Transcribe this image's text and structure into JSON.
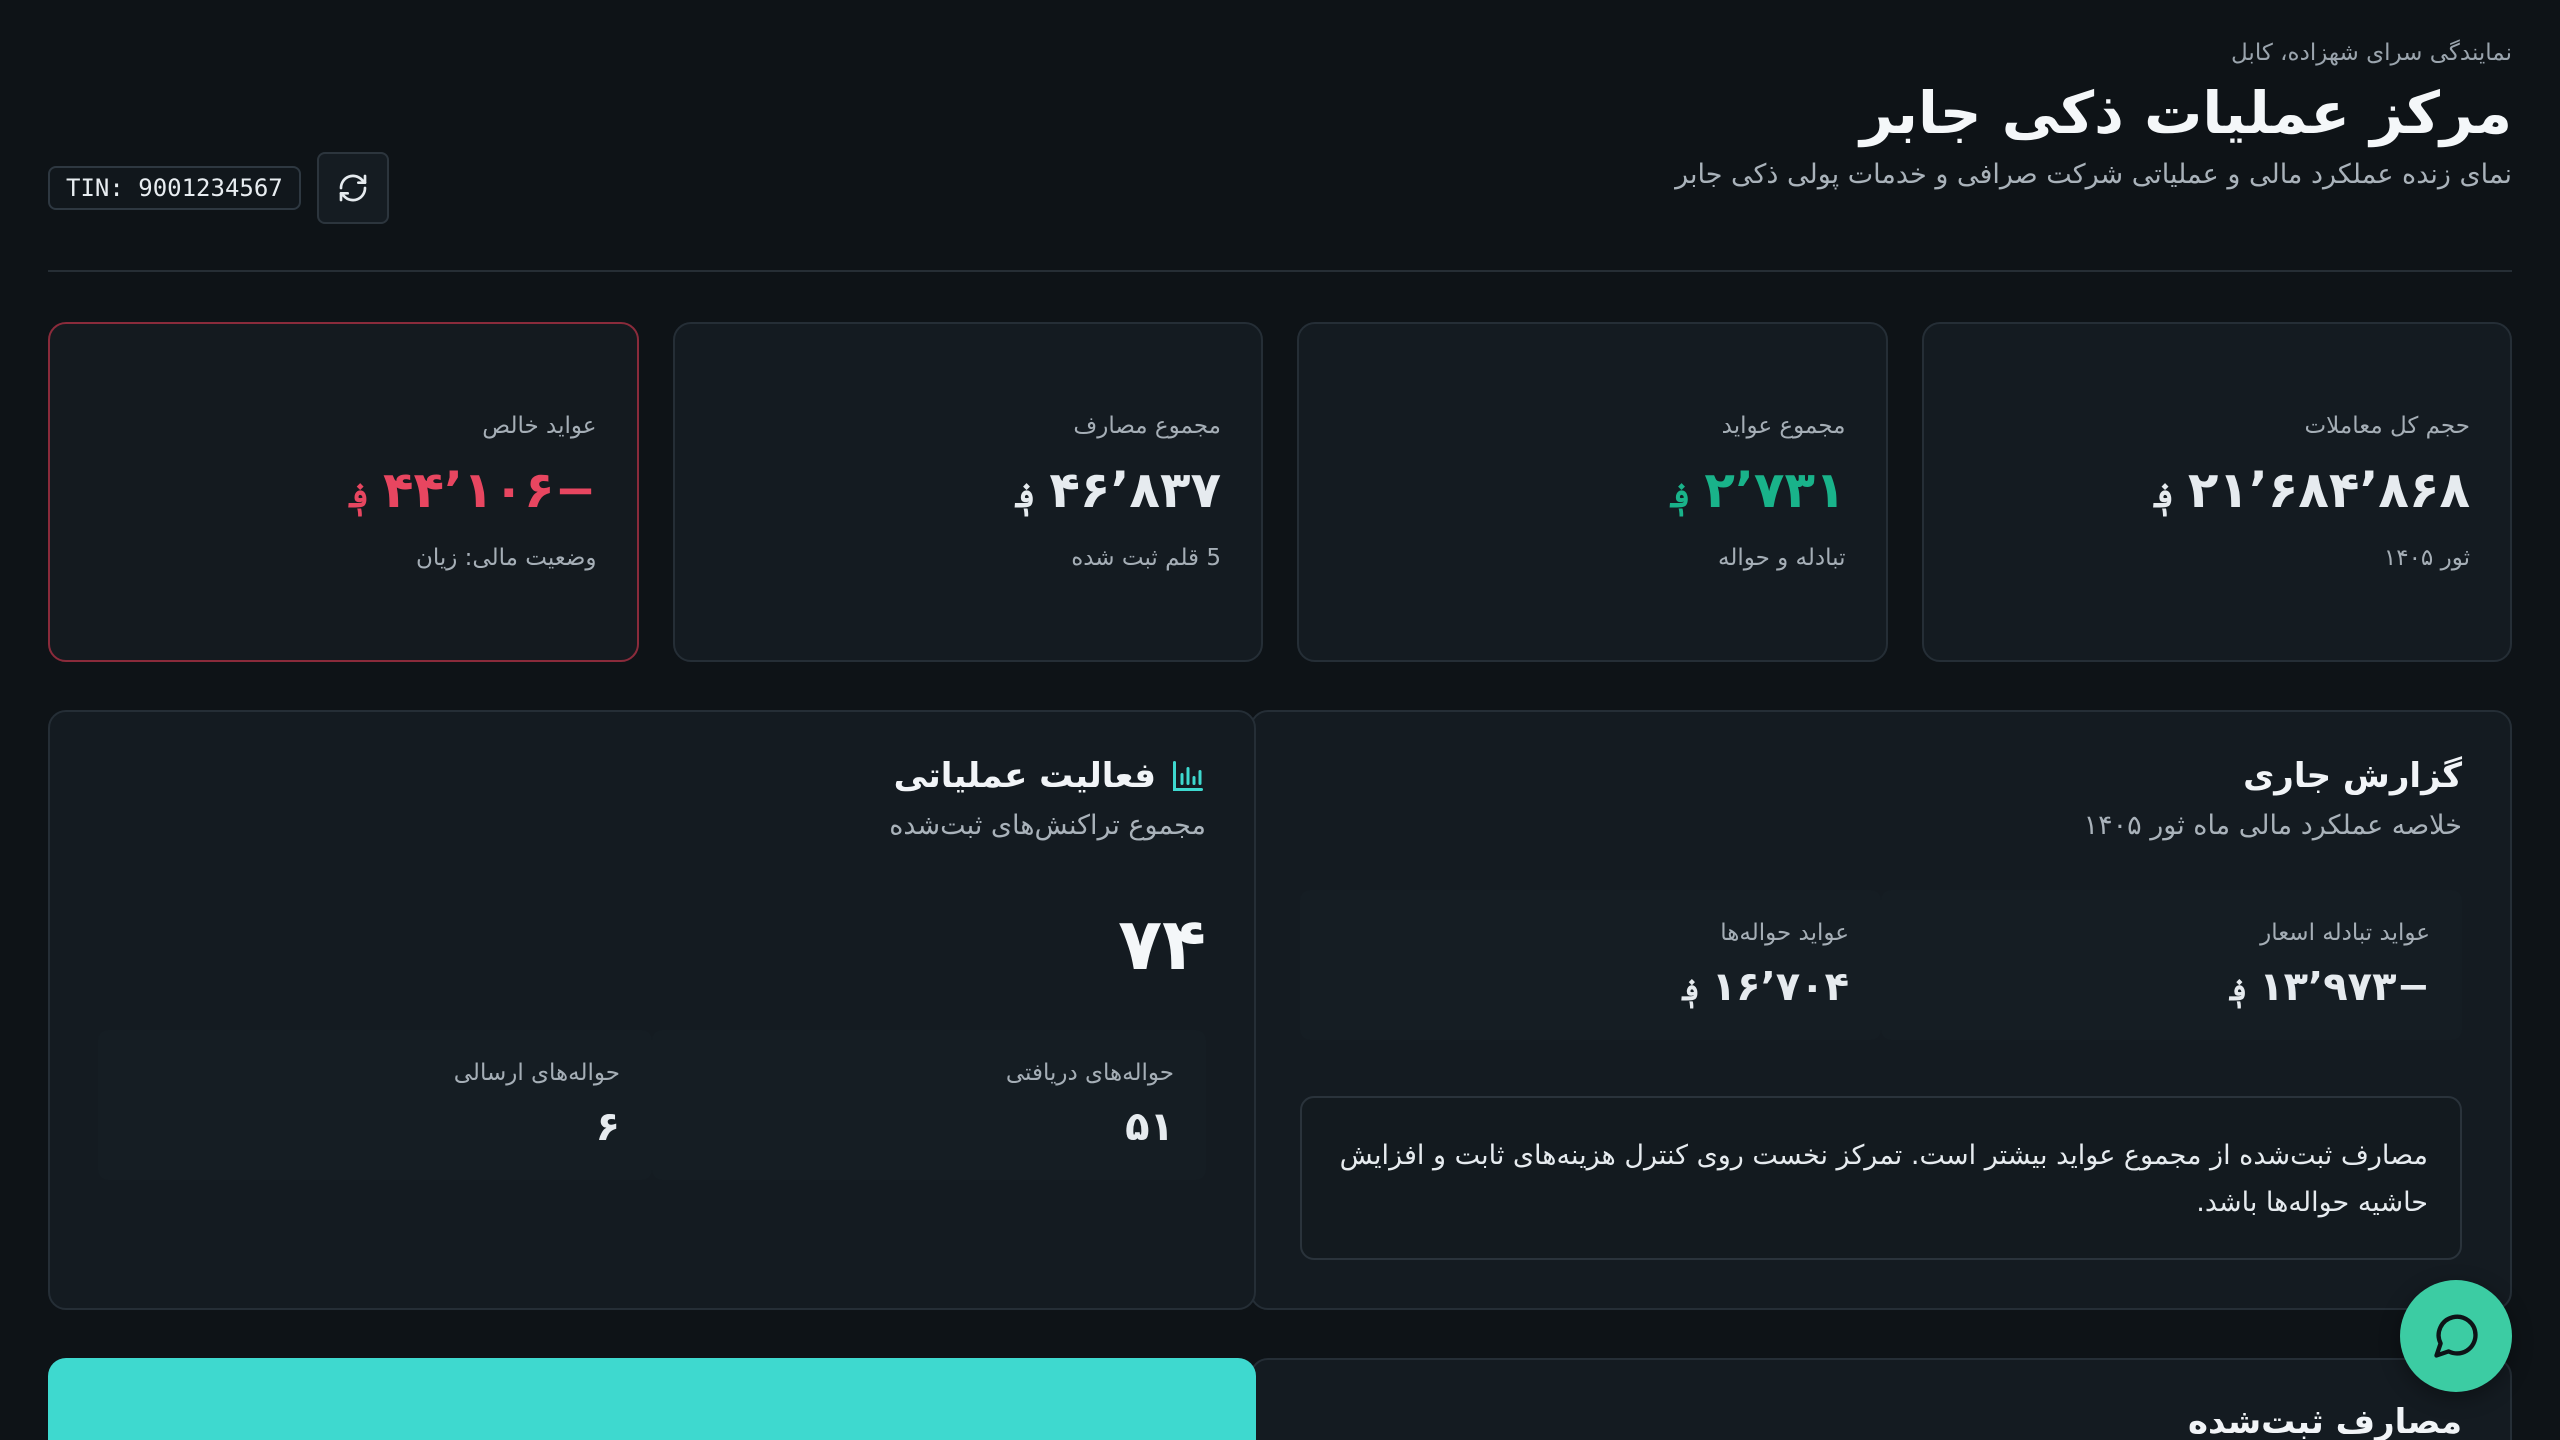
{
  "header": {
    "location": "نمایندگی سرای شهزاده، کابل",
    "title": "مرکز عملیات ذکی جابر",
    "subtitle": "نمای زنده عملکرد مالی و عملیاتی شرکت صرافی و خدمات پولی ذکی جابر",
    "tin": "TIN: 9001234567",
    "refresh_icon": "refresh-icon"
  },
  "stats": [
    {
      "label": "حجم کل معاملات",
      "value": "۲۱٬۶۸۴٬۸۶۸",
      "currency": "؋",
      "note": "ثور ۱۴۰۵",
      "color": "#e6ebef"
    },
    {
      "label": "مجموع عواید",
      "value": "۲٬۷۳۱",
      "currency": "؋",
      "note": "تبادله و حواله",
      "color": "#19b38a"
    },
    {
      "label": "مجموع مصارف",
      "value": "۴۶٬۸۳۷",
      "currency": "؋",
      "note": "5 قلم ثبت شده",
      "color": "#e6ebef"
    },
    {
      "label": "عواید خالص",
      "value": "−۴۴٬۱۰۶",
      "currency": "؋",
      "note": "وضعیت مالی: زیان",
      "color": "#e84660"
    }
  ],
  "report": {
    "title": "گزارش جاری",
    "subtitle": "خلاصه عملکرد مالی ماه ثور ۱۴۰۵",
    "fx_label": "عواید تبادله اسعار",
    "fx_value": "−۱۳٬۹۷۳",
    "fx_currency": "؋",
    "remit_label": "عواید حواله‌ها",
    "remit_value": "۱۶٬۷۰۴",
    "remit_currency": "؋",
    "note": "مصارف ثبت‌شده از مجموع عواید بیشتر است. تمرکز نخست روی کنترل هزینه‌های ثابت و افزایش حاشیه حواله‌ها باشد."
  },
  "activity": {
    "title": "فعالیت عملیاتی",
    "icon": "bar-chart-icon",
    "subtitle": "مجموع تراکنش‌های ثبت‌شده",
    "total": "۷۴",
    "received_label": "حواله‌های دریافتی",
    "received_value": "۵۱",
    "sent_label": "حواله‌های ارسالی",
    "sent_value": "۶"
  },
  "expenses": {
    "title": "مصارف ثبت‌شده"
  },
  "colors": {
    "background": "#0e1317",
    "card": "#141b21",
    "accent_teal": "#3ed9cf",
    "fab": "#3ccca3",
    "positive": "#19b38a",
    "negative": "#e84660"
  }
}
